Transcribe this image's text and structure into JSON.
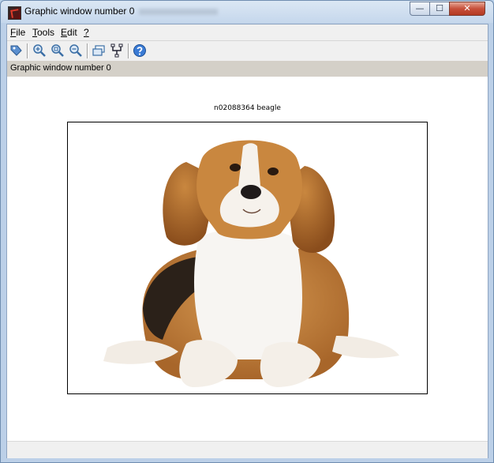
{
  "window": {
    "title": "Graphic window number 0",
    "controls": {
      "minimize": "—",
      "maximize": "☐",
      "close": "✕"
    }
  },
  "menu": {
    "file": {
      "first": "F",
      "rest": "ile"
    },
    "tools": {
      "first": "T",
      "rest": "ools"
    },
    "edit": {
      "first": "E",
      "rest": "dit"
    },
    "help": {
      "first": "?",
      "rest": ""
    }
  },
  "toolbar": {
    "icons": [
      "datatip-icon",
      "zoom-in-icon",
      "zoom-fit-icon",
      "zoom-out-icon",
      "rotate-icon",
      "graphics-tree-icon",
      "help-icon"
    ]
  },
  "info_bar": {
    "text": "Graphic window number 0"
  },
  "figure": {
    "title": "n02088364 beagle"
  },
  "colors": {
    "titlebar": "#c5d7ec",
    "accent": "#3a6ea5",
    "close": "#c7503a"
  }
}
